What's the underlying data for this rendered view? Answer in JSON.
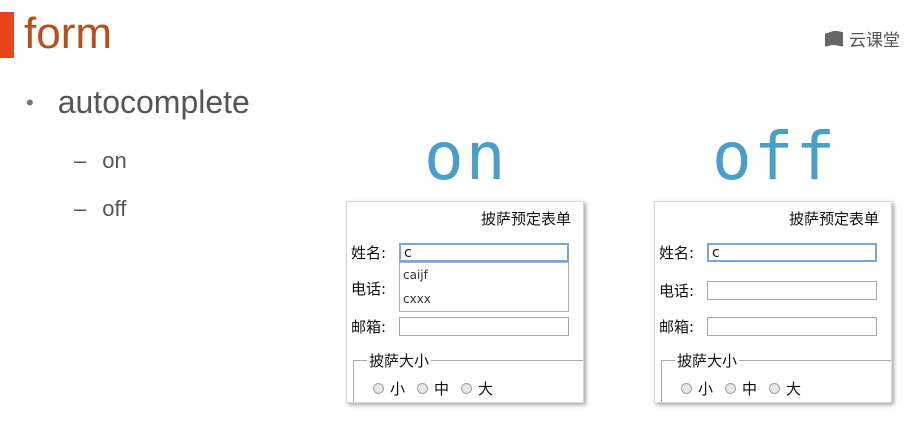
{
  "slide": {
    "title": "form",
    "brand": "云课堂",
    "bullet": "autocomplete",
    "sub_items": [
      "on",
      "off"
    ]
  },
  "examples": [
    {
      "label": "on",
      "form_title": "披萨预定表单",
      "fields": [
        {
          "label": "姓名:",
          "value": "c"
        },
        {
          "label": "电话:",
          "value": ""
        },
        {
          "label": "邮箱:",
          "value": ""
        }
      ],
      "suggestions": [
        "caijf",
        "cxxx"
      ],
      "fieldset_legend": "披萨大小",
      "sizes": [
        "小",
        "中",
        "大"
      ]
    },
    {
      "label": "off",
      "form_title": "披萨预定表单",
      "fields": [
        {
          "label": "姓名:",
          "value": "c"
        },
        {
          "label": "电话:",
          "value": ""
        },
        {
          "label": "邮箱:",
          "value": ""
        }
      ],
      "suggestions": [],
      "fieldset_legend": "披萨大小",
      "sizes": [
        "小",
        "中",
        "大"
      ]
    }
  ],
  "colors": {
    "accent_bar": "#e8451e",
    "title": "#b5501a",
    "big_label": "#4a9fc8"
  }
}
